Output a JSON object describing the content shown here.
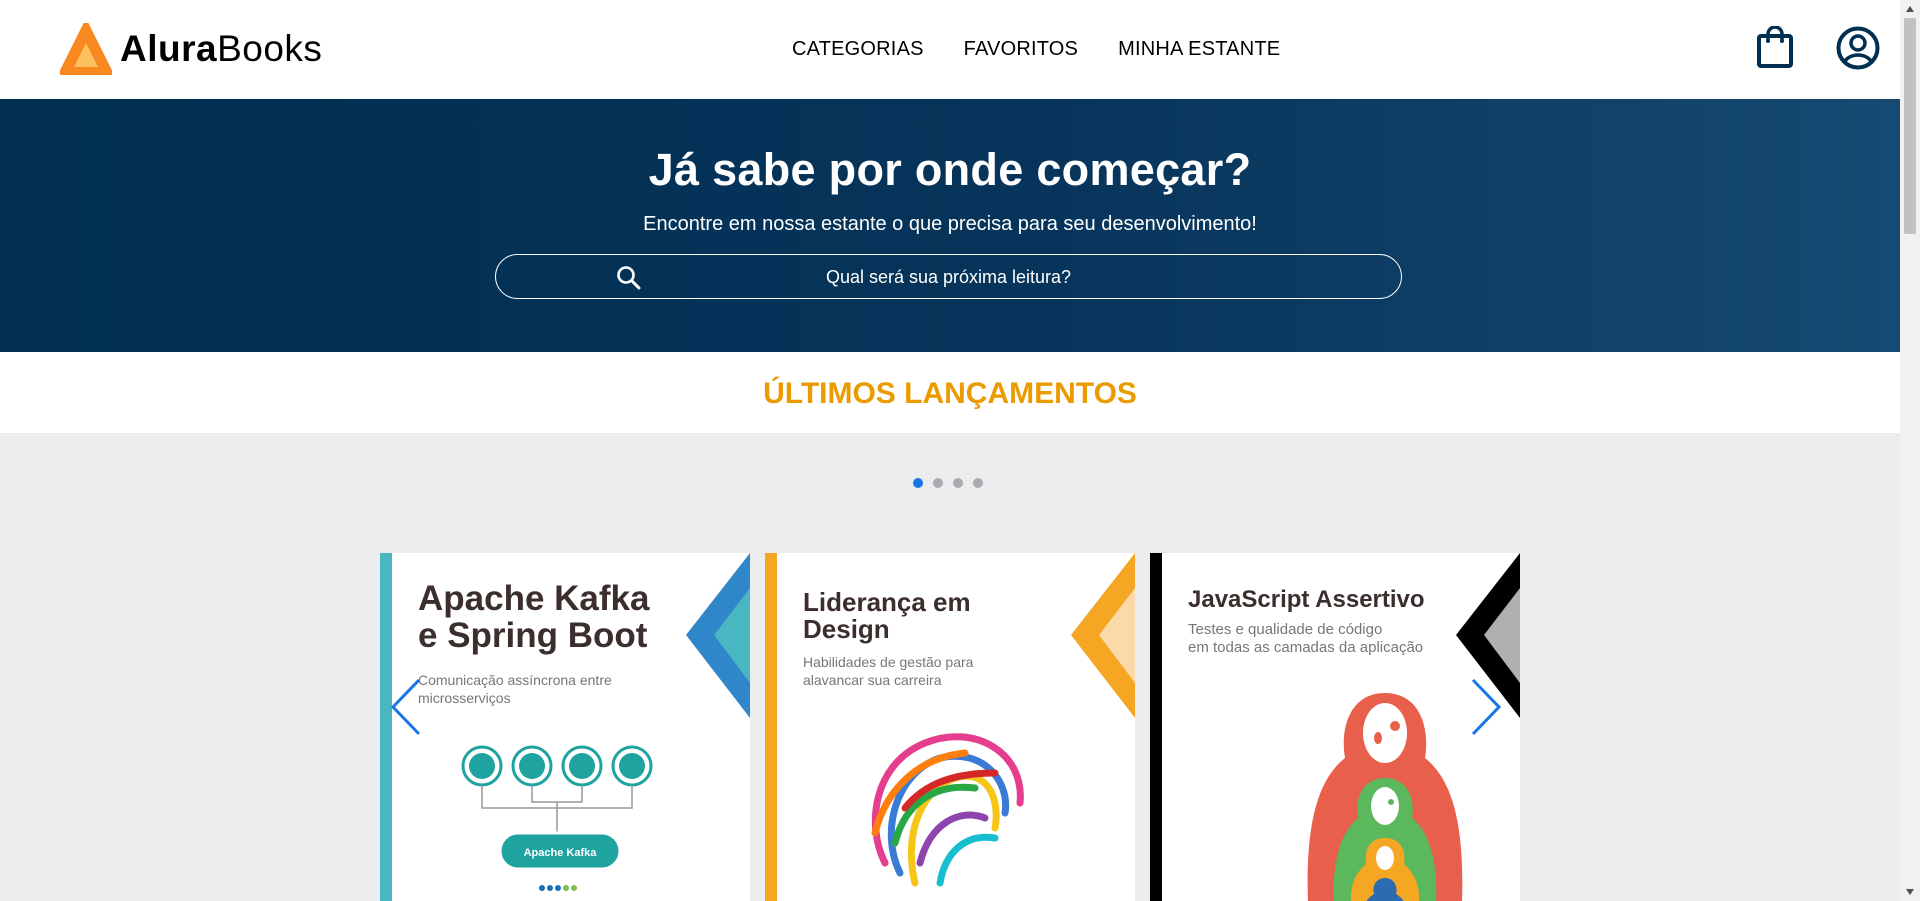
{
  "brand": {
    "part1": "Alura",
    "part2": "Books",
    "accent": "#f7891f"
  },
  "nav": {
    "items": [
      "CATEGORIAS",
      "FAVORITOS",
      "MINHA ESTANTE"
    ]
  },
  "header_icons": [
    "shopping-bag-icon",
    "user-icon"
  ],
  "hero": {
    "title": "Já sabe por onde começar?",
    "subtitle": "Encontre em nossa estante o que precisa para seu desenvolvimento!",
    "search_placeholder": "Qual será sua próxima leitura?"
  },
  "releases": {
    "title": "ÚLTIMOS LANÇAMENTOS",
    "dots": 4,
    "active_dot": 0,
    "books": [
      {
        "title_line1": "Apache Kafka",
        "title_line2": "e Spring Boot",
        "subtitle_line1": "Comunicação assíncrona entre microsserviços",
        "subtitle_line2": "",
        "diagram_label": "Apache Kafka",
        "accent": "#48b7c2"
      },
      {
        "title_line1": "Liderança em",
        "title_line2": "Design",
        "subtitle_line1": "Habilidades de gestão para",
        "subtitle_line2": "alavancar sua carreira",
        "accent": "#f5a623"
      },
      {
        "title_line1": "JavaScript Assertivo",
        "title_line2": "",
        "subtitle_line1": "Testes e qualidade de código",
        "subtitle_line2": "em todas as camadas da aplicação",
        "accent": "#000000"
      }
    ]
  },
  "colors": {
    "hero_bg": "#002f52",
    "title_orange": "#eb9b00",
    "carousel_bg": "#ebecee",
    "arrow_blue": "#1875e8"
  }
}
